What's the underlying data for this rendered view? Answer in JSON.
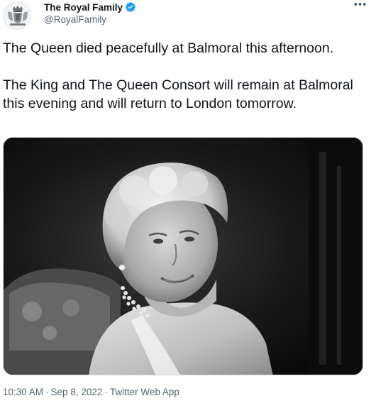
{
  "account": {
    "display_name": "The Royal Family",
    "handle": "@RoyalFamily",
    "verified_icon": "verified-badge-icon",
    "avatar_icon": "royal-crest-icon",
    "more_icon": "more-options-icon"
  },
  "tweet": {
    "text": "The Queen died peacefully at Balmoral this afternoon.\n\nThe King and The Queen Consort will remain at Balmoral this evening and will return to London tomorrow.",
    "photo": "black-and-white portrait photo"
  },
  "meta": {
    "time": "10:30 AM",
    "separator": "·",
    "date": "Sep 8, 2022",
    "source": "Twitter Web App"
  },
  "colors": {
    "text": "#0f1419",
    "secondary": "#536471",
    "verified": "#1d9bf0"
  }
}
